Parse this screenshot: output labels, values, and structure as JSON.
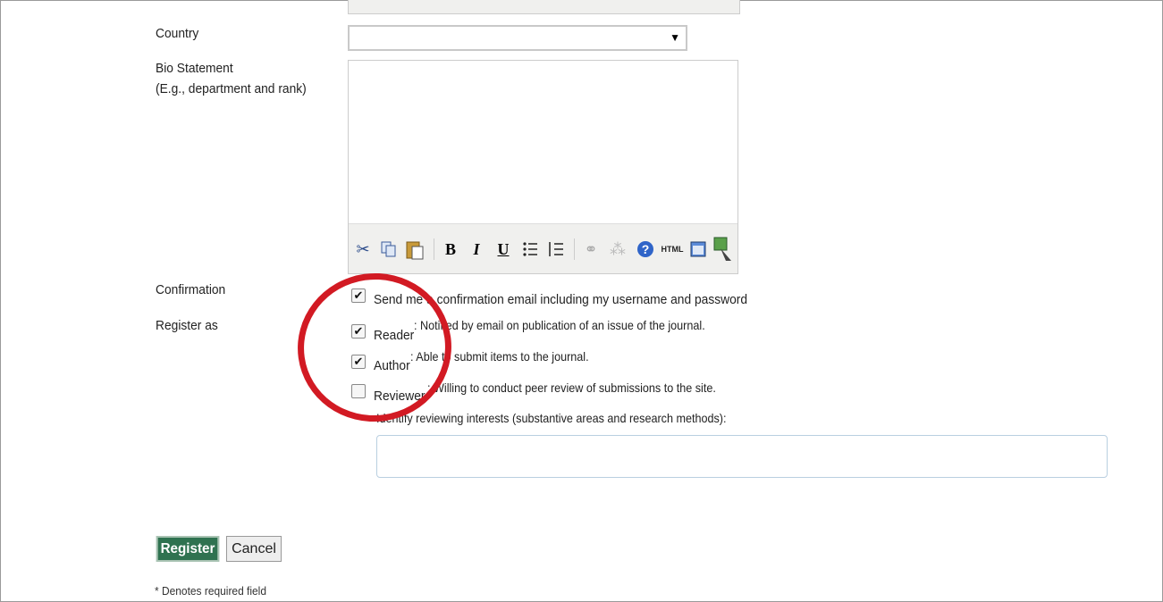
{
  "form": {
    "country_label": "Country",
    "country_value": "",
    "bio_label": "Bio Statement",
    "bio_hint": "(E.g., department and rank)",
    "confirmation_label": "Confirmation",
    "confirmation_text": "Send me a confirmation email including my username and password",
    "confirmation_checked": true,
    "register_as_label": "Register as",
    "roles": [
      {
        "label": "Reader",
        "desc": ": Notified by email on publication of an issue of the journal.",
        "checked": true
      },
      {
        "label": "Author",
        "desc": ": Able to submit items to the journal.",
        "checked": true
      },
      {
        "label": "Reviewer",
        "desc": ": Willing to conduct peer review of submissions to the site.",
        "checked": false
      }
    ],
    "interests_label": "Identify reviewing interests (substantive areas and research methods):",
    "interests_value": "",
    "register_button": "Register",
    "cancel_button": "Cancel",
    "required_note": "* Denotes required field"
  },
  "editor_toolbar": [
    "cut-icon",
    "copy-icon",
    "paste-icon",
    "bold-icon",
    "italic-icon",
    "underline-icon",
    "bullet-list-icon",
    "numbered-list-icon",
    "link-icon",
    "unlink-icon",
    "help-icon",
    "html-icon",
    "fullscreen-icon",
    "image-upload-icon"
  ],
  "toolbar_glyphs": {
    "bold": "B",
    "italic": "I",
    "underline": "U",
    "html": "HTML"
  },
  "colors": {
    "register_bg": "#2f7250",
    "annotation": "#d21a23"
  }
}
